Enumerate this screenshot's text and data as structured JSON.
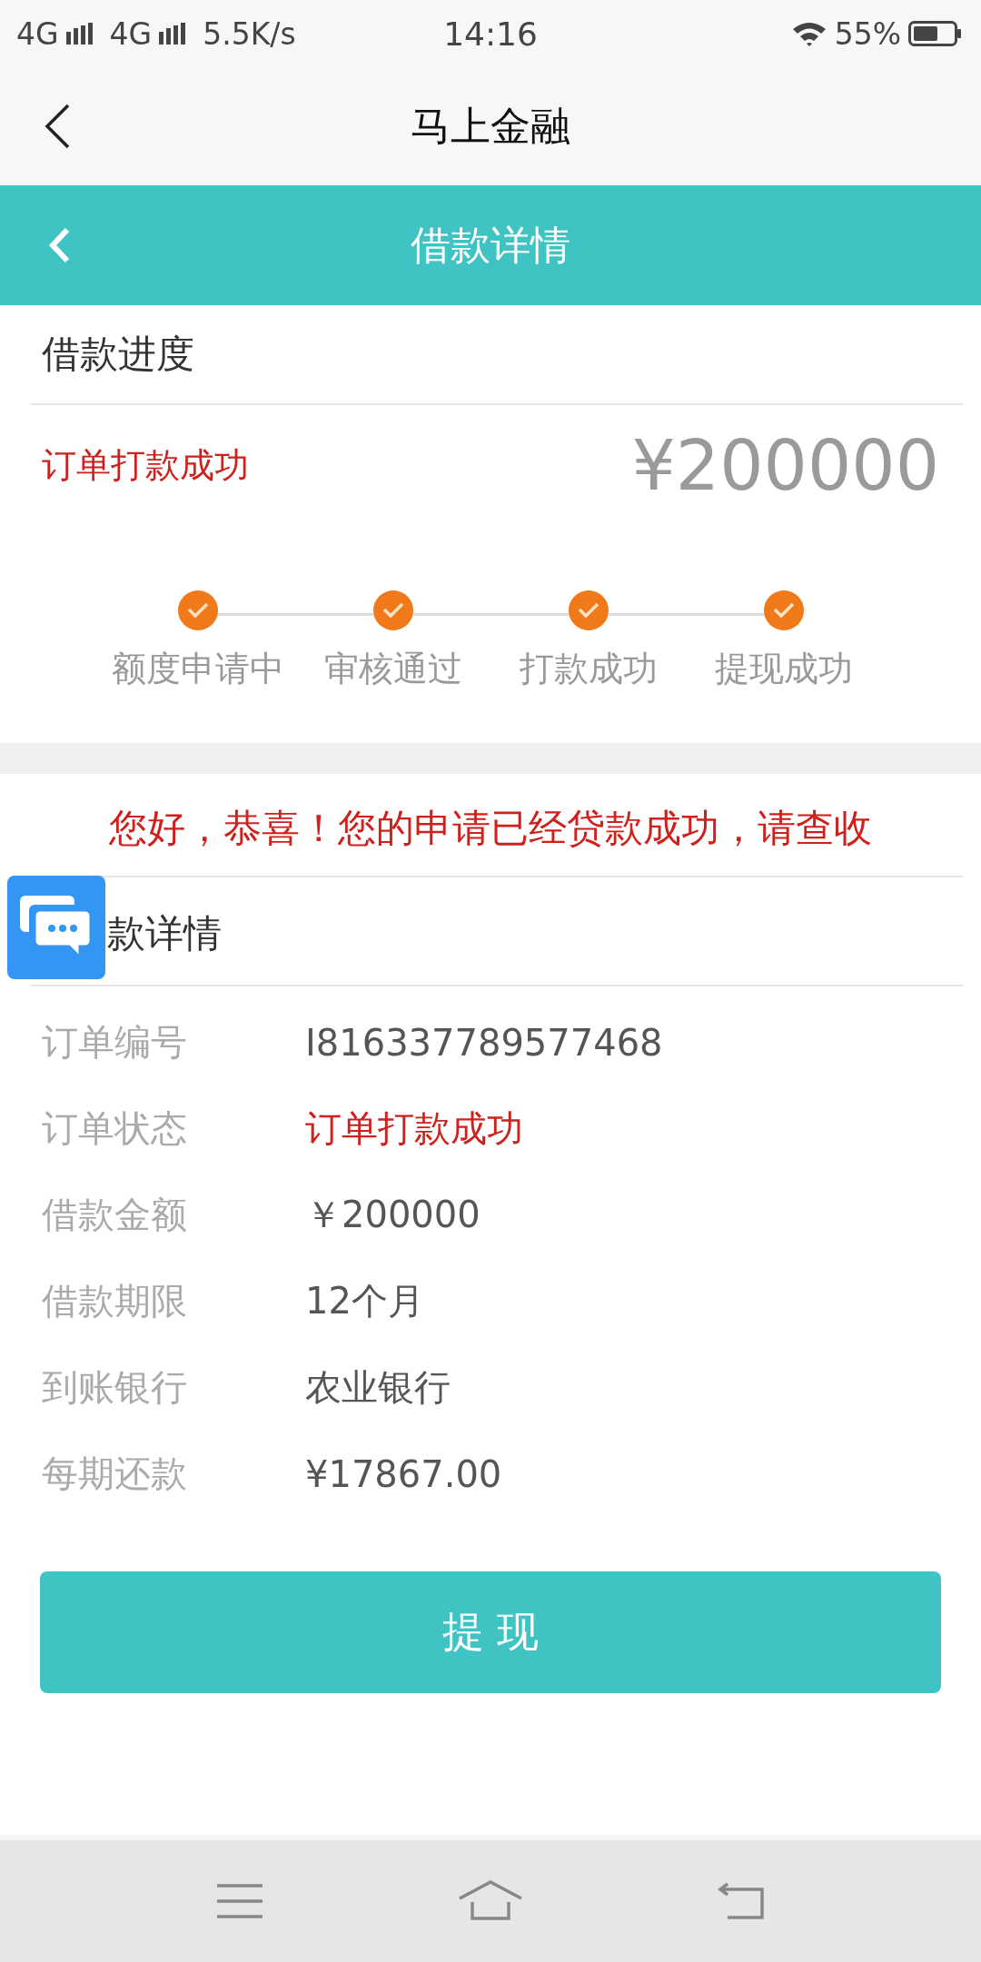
{
  "status_bar": {
    "network_1": "4G",
    "network_2": "4G",
    "speed": "5.5K/s",
    "time": "14:16",
    "battery": "55%"
  },
  "app_bar": {
    "title": "马上金融"
  },
  "header": {
    "title": "借款详情"
  },
  "progress": {
    "title": "借款进度",
    "status": "订单打款成功",
    "amount": "¥200000",
    "steps": [
      {
        "label": "额度申请中",
        "done": true
      },
      {
        "label": "审核通过",
        "done": true
      },
      {
        "label": "打款成功",
        "done": true
      },
      {
        "label": "提现成功",
        "done": true
      }
    ]
  },
  "notice": "您好，恭喜！您的申请已经贷款成功，请查收",
  "details": {
    "title": "款详情",
    "rows": [
      {
        "label": "订单编号",
        "value": "I816337789577468",
        "kind": "plain"
      },
      {
        "label": "订单状态",
        "value": "订单打款成功",
        "kind": "alert"
      },
      {
        "label": "借款金额",
        "value": "￥200000",
        "kind": "plain"
      },
      {
        "label": "借款期限",
        "value": "12个月",
        "kind": "plain"
      },
      {
        "label": "到账银行",
        "value": "农业银行",
        "kind": "plain"
      },
      {
        "label": "每期还款",
        "value": "¥17867.00",
        "kind": "plain"
      }
    ]
  },
  "button": "提 现"
}
